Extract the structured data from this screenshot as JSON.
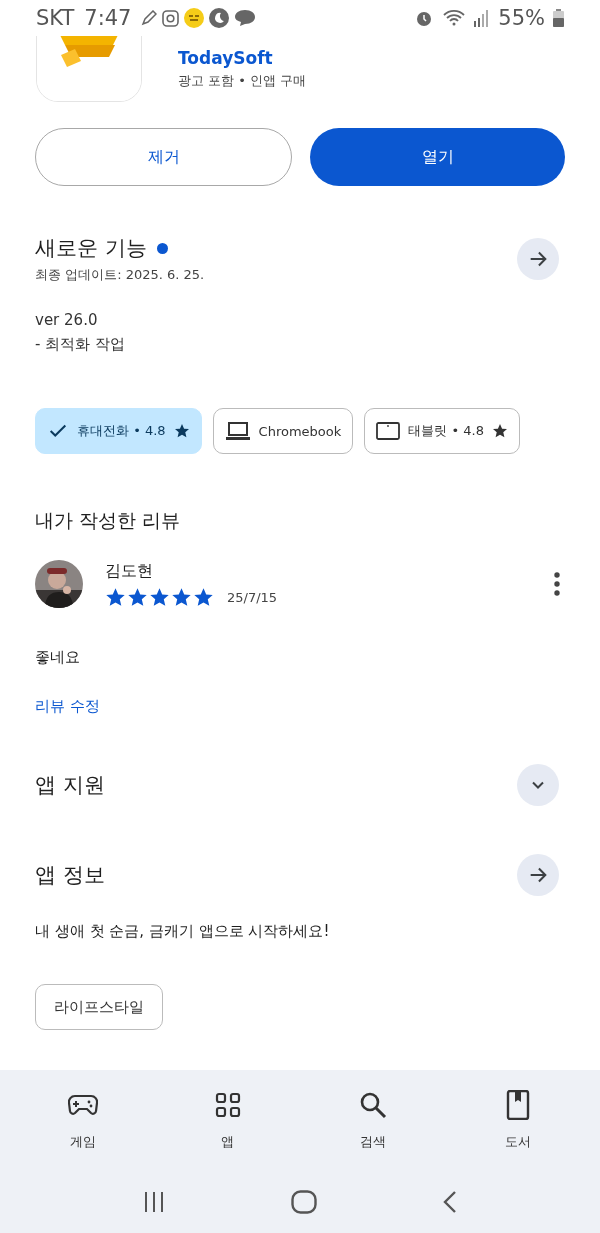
{
  "status_bar": {
    "carrier": "SKT",
    "time": "7:47",
    "battery": "55%"
  },
  "app": {
    "developer": "TodaySoft",
    "notes": "광고 포함 • 인앱 구매"
  },
  "actions": [
    {
      "label": "제거",
      "kind": "outlined"
    },
    {
      "label": "열기",
      "kind": "filled"
    }
  ],
  "whats_new": {
    "title": "새로운 기능",
    "new": true,
    "updated": "최종 업데이트: 2025. 6. 25.",
    "lines": [
      "ver 26.0",
      "- 최적화 작업"
    ]
  },
  "devices": [
    {
      "label": "휴대전화 • 4.8",
      "selected": true,
      "star": true
    },
    {
      "label": "Chromebook",
      "kind": "laptop",
      "selected": false,
      "star": false
    },
    {
      "label": "태블릿 • 4.8",
      "kind": "tablet",
      "selected": false,
      "star": true
    }
  ],
  "my_review": {
    "title": "내가 작성한 리뷰",
    "author": "김도현",
    "stars": 5,
    "date": "25/7/15",
    "text": "좋네요",
    "edit_link": "리뷰 수정"
  },
  "sections": [
    {
      "title": "앱 지원",
      "kind": "expand"
    },
    {
      "title": "앱 정보",
      "kind": "arrow",
      "description": "내 생애 첫 순금, 금캐기 앱으로 시작하세요!",
      "tags": [
        "라이프스타일"
      ]
    }
  ],
  "nav": [
    {
      "label": "게임",
      "kind": "games",
      "selected": false
    },
    {
      "label": "앱",
      "kind": "apps",
      "selected": false
    },
    {
      "label": "검색",
      "kind": "search",
      "selected": false
    },
    {
      "label": "도서",
      "kind": "books",
      "selected": false
    }
  ]
}
